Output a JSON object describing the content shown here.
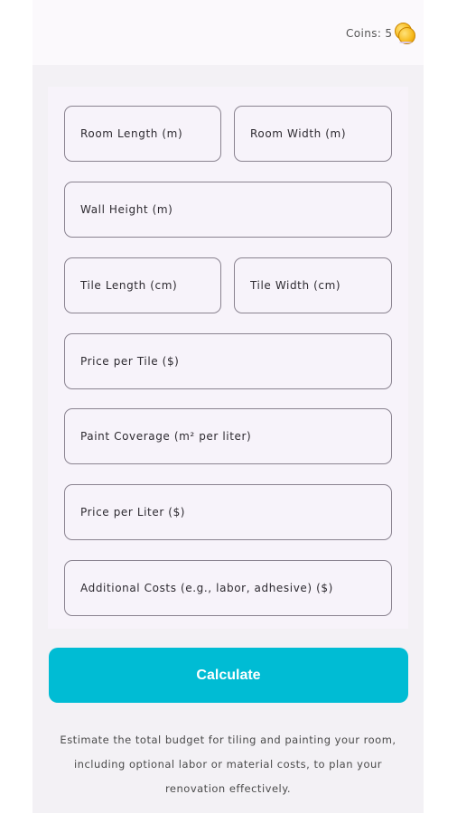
{
  "header": {
    "coins_label": "Coins:",
    "coins_value": "5",
    "coin_icon": "coin-stack-icon"
  },
  "form": {
    "room_length": {
      "placeholder": "Room Length (m)",
      "value": ""
    },
    "room_width": {
      "placeholder": "Room Width (m)",
      "value": ""
    },
    "wall_height": {
      "placeholder": "Wall Height (m)",
      "value": ""
    },
    "tile_length": {
      "placeholder": "Tile Length (cm)",
      "value": ""
    },
    "tile_width": {
      "placeholder": "Tile Width (cm)",
      "value": ""
    },
    "price_per_tile": {
      "placeholder": "Price per Tile ($)",
      "value": ""
    },
    "paint_coverage": {
      "placeholder": "Paint Coverage (m² per liter)",
      "value": ""
    },
    "price_per_liter": {
      "placeholder": "Price per Liter ($)",
      "value": ""
    },
    "additional_costs": {
      "placeholder": "Additional Costs (e.g., labor, adhesive) ($)",
      "value": ""
    }
  },
  "actions": {
    "calculate_label": "Calculate"
  },
  "description": "Estimate the total budget for tiling and painting your room, including optional labor or material costs, to plan your renovation effectively.",
  "colors": {
    "accent": "#00bcd4",
    "background": "#f3f1f5",
    "field_border": "#8a8390"
  }
}
